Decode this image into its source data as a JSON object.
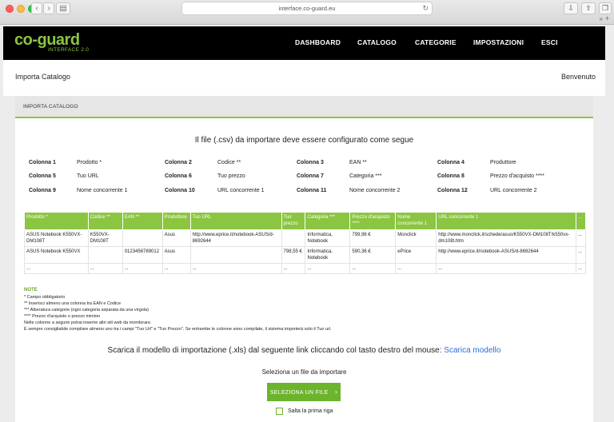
{
  "browser": {
    "url": "interface.co-guard.eu"
  },
  "brand": {
    "name": "co-guard",
    "sub": "INTERFACE 2.0",
    "accent": "#8bc541"
  },
  "nav": {
    "dashboard": "DASHBOARD",
    "catalogo": "CATALOGO",
    "categorie": "CATEGORIE",
    "impostazioni": "IMPOSTAZIONI",
    "esci": "ESCI"
  },
  "subbar": {
    "title": "Importa Catalogo",
    "welcome": "Benvenuto"
  },
  "panel": {
    "header": "IMPORTA CATALOGO",
    "config_title": "Il file (.csv) da importare deve essere configurato come segue"
  },
  "columns": [
    {
      "label": "Colonna 1",
      "value": "Prodotto *"
    },
    {
      "label": "Colonna 2",
      "value": "Codice **"
    },
    {
      "label": "Colonna 3",
      "value": "EAN **"
    },
    {
      "label": "Colonna 4",
      "value": "Produttore"
    },
    {
      "label": "Colonna 5",
      "value": "Tuo URL"
    },
    {
      "label": "Colonna 6",
      "value": "Tuo prezzo"
    },
    {
      "label": "Colonna 7",
      "value": "Categoria ***"
    },
    {
      "label": "Colonna 8",
      "value": "Prezzo d'acquisto ****"
    },
    {
      "label": "Colonna 9",
      "value": "Nome concorrente 1"
    },
    {
      "label": "Colonna 10",
      "value": "URL concorrente 1"
    },
    {
      "label": "Colonna 11",
      "value": "Nome concorrente 2"
    },
    {
      "label": "Colonna 12",
      "value": "URL concorrente 2"
    }
  ],
  "table": {
    "headers": [
      "Prodotto *",
      "Codice **",
      "EAN **",
      "Produttore",
      "Tuo URL",
      "Tuo prezzo",
      "Categoria ***",
      "Prezzo d'acquisto ****",
      "Nome concorrente 1",
      "URL concorrente 1",
      "..."
    ],
    "rows": [
      [
        "ASUS Notebook K550VX-DM108T",
        "K550VX-DM108T",
        "",
        "Asus",
        "http://www.eprice.it/notebook-ASUS/d-8692644",
        "",
        "Informatica, Notebook",
        "799,96 €",
        "Monclick",
        "http://www.monclick.it/schede/asus/K550VX-DM108T/k550vx-dm108t.htm",
        "..."
      ],
      [
        "ASUS Notebook K550VX",
        "",
        "0123456789012",
        "Asus",
        "",
        "798,55 €",
        "Informatica, Notebook",
        "590,36 €",
        "ePrice",
        "http://www.eprice.it/notebook-ASUS/d-8692644",
        "..."
      ],
      [
        "...",
        "...",
        "...",
        "...",
        "...",
        "...",
        "...",
        "...",
        "...",
        "...",
        "..."
      ]
    ]
  },
  "notes": {
    "title": "NOTE",
    "lines": [
      "* Campo obbligatorio",
      "** Inserisci almeno una colonna tra EAN e Codice",
      "*** Alberatura categorie (ogni categoria separata da una virgola)",
      "**** Prezzo d'acquisto o prezzo minimo",
      "Nelle colonne a seguire potrai inserire altri siti web da monitorare.",
      "È sempre consigliabile compilare almeno uno tra i campi \"Tuo Url\" e \"Tuo Prezzo\". Se entrambe le colonne sono compilate, il sistema importerà solo il Tuo url."
    ]
  },
  "download": {
    "text": "Scarica il modello di importazione (.xls) dal seguente link cliccando col tasto destro del mouse:",
    "link": "Scarica modello"
  },
  "upload": {
    "label": "Seleziona un file da importare",
    "button": "SELEZIONA UN FILE",
    "skip_label": "Salta la prima riga"
  }
}
